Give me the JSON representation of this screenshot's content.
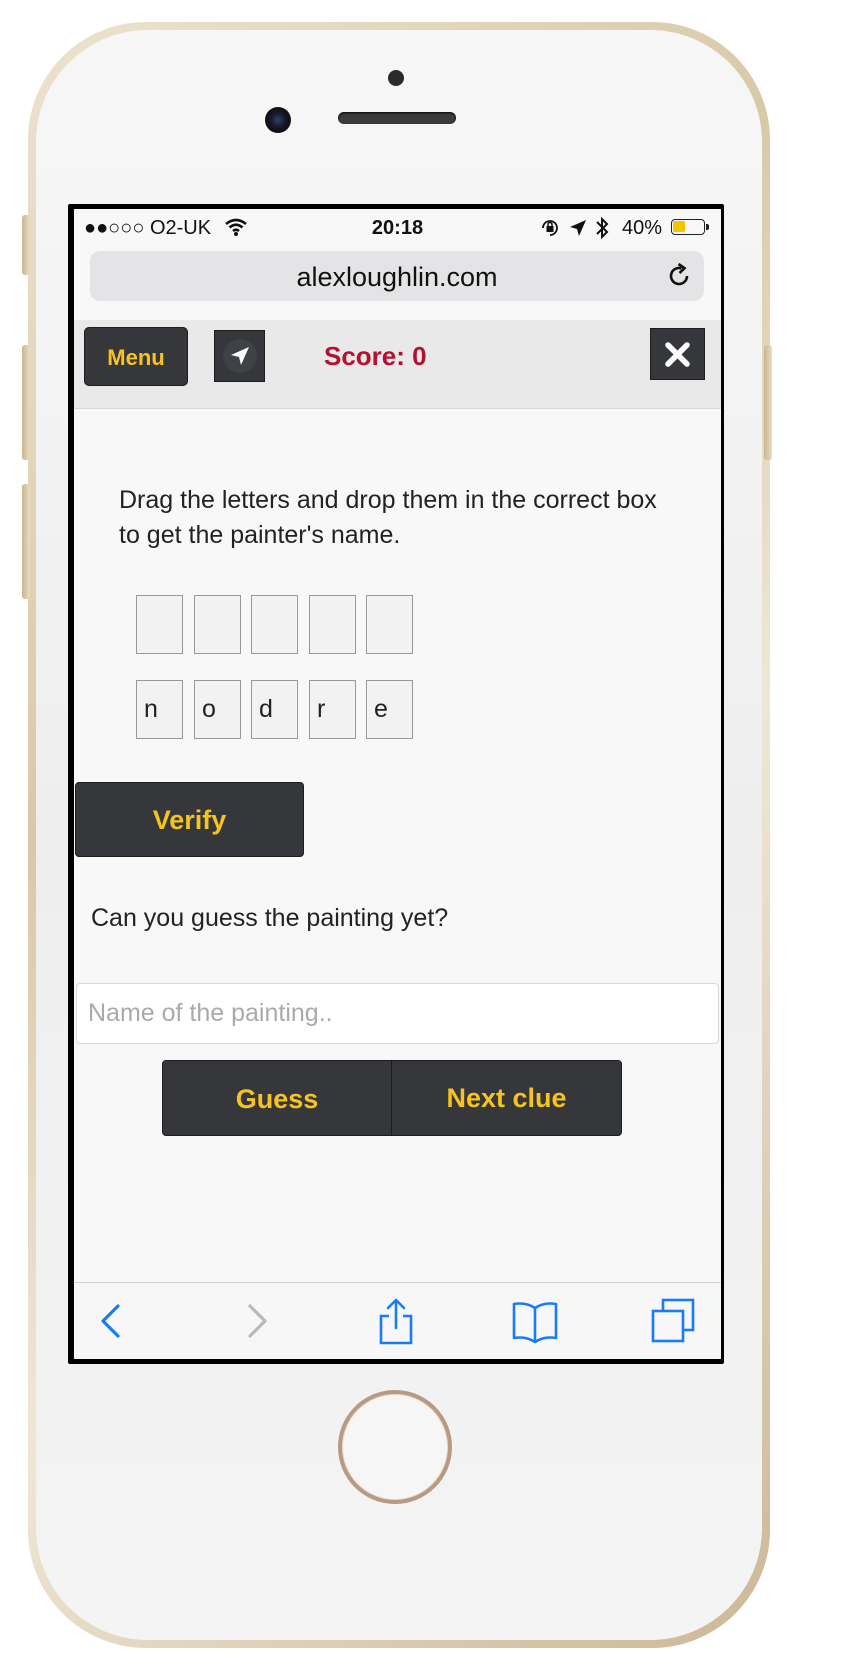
{
  "status_bar": {
    "carrier": "●●○○○ O2-UK",
    "time": "20:18",
    "battery_percent": "40%",
    "battery_level": 0.4,
    "battery_color": "#f5c400"
  },
  "browser": {
    "url": "alexloughlin.com"
  },
  "header": {
    "menu_label": "Menu",
    "score_text": "Score: 0",
    "score_color": "#b5102f",
    "accent_color": "#f7c41f",
    "button_bg": "#35373b"
  },
  "puzzle": {
    "instructions": "Drag the letters and drop them in the correct box to get the painter's name.",
    "answer_slots": [
      "",
      "",
      "",
      "",
      ""
    ],
    "letters": [
      "n",
      "o",
      "d",
      "r",
      "e"
    ],
    "verify_label": "Verify"
  },
  "guess_section": {
    "question": "Can you guess the painting yet?",
    "input_placeholder": "Name of the painting..",
    "input_value": "",
    "guess_label": "Guess",
    "next_clue_label": "Next clue"
  },
  "toolbar": {
    "icons": [
      "back-icon",
      "forward-icon",
      "share-icon",
      "bookmarks-icon",
      "tabs-icon"
    ]
  }
}
